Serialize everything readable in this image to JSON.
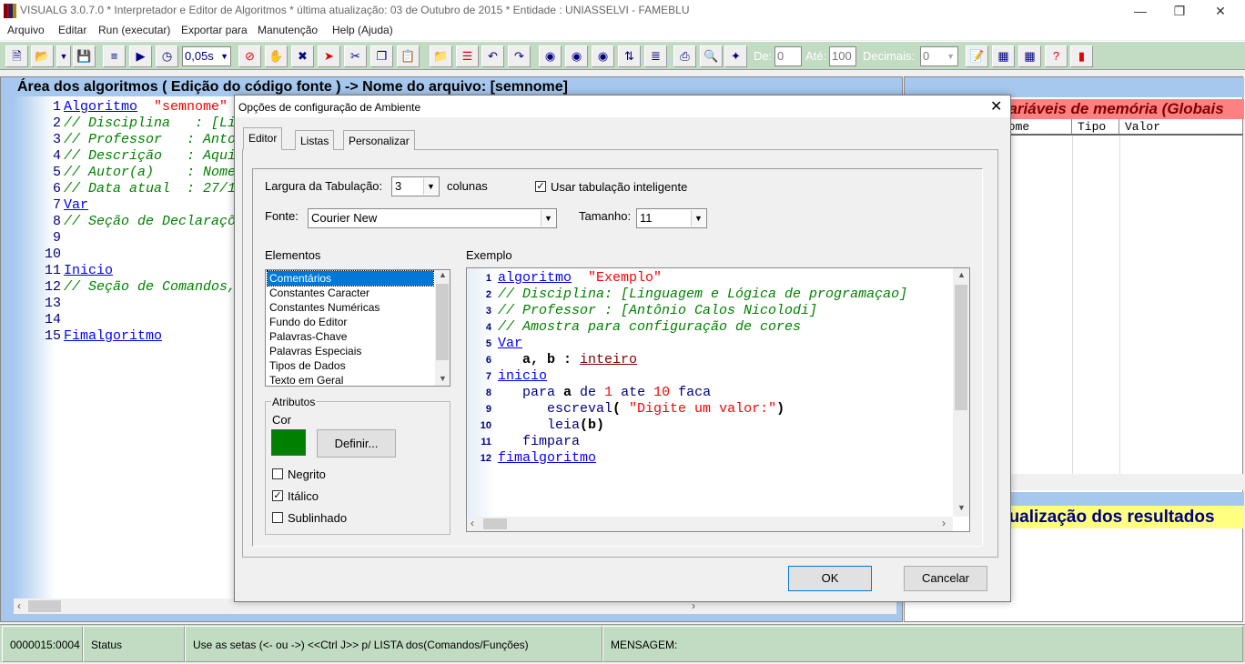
{
  "window": {
    "title": "VISUALG 3.0.7.0 * Interpretador e Editor de Algoritmos * última atualização: 03 de Outubro de 2015 * Entidade : UNIASSELVI - FAMEBLU",
    "controls": [
      "minimize-icon",
      "maximize-icon",
      "close-icon"
    ]
  },
  "menu": [
    "Arquivo",
    "Editar",
    "Run (executar)",
    "Exportar para",
    "Manutenção",
    "Help (Ajuda)"
  ],
  "toolbar": {
    "speed": "0,05s",
    "de_label": "De:",
    "de_value": "0",
    "ate_label": "Até:",
    "ate_value": "100",
    "decimais_label": "Decimais:",
    "decimais_value": "0",
    "icons": [
      "new-file-icon",
      "open-folder-icon",
      "dropdown-icon",
      "save-icon",
      "indent-icon",
      "run-step-icon",
      "timer-icon",
      "stop-icon",
      "hand-icon",
      "no-hand-icon",
      "run-to-icon",
      "cut-icon",
      "copy-icon",
      "paste-icon",
      "export-icon",
      "breakpoint-icon",
      "undo-icon",
      "redo-icon",
      "find-icon",
      "find-next-icon",
      "replace-icon",
      "sort-icon",
      "outdent-icon",
      "print-icon",
      "print-preview-icon",
      "wand-icon",
      "notes-icon",
      "calculator-icon",
      "calendar-icon",
      "help-icon",
      "exit-icon"
    ]
  },
  "editor": {
    "title": "Área dos algoritmos ( Edição do código fonte ) -> Nome do arquivo: [semnome]",
    "lines": [
      [
        [
          "kw",
          "Algoritmo"
        ],
        [
          "",
          "  "
        ],
        [
          "str",
          "\"semnome\""
        ]
      ],
      [
        [
          "cm",
          "// Disciplina   : [Li"
        ]
      ],
      [
        [
          "cm",
          "// Professor   : Anto"
        ]
      ],
      [
        [
          "cm",
          "// Descrição   : Aqui"
        ]
      ],
      [
        [
          "cm",
          "// Autor(a)    : Nome"
        ]
      ],
      [
        [
          "cm",
          "// Data atual  : 27/1"
        ]
      ],
      [
        [
          "kw",
          "Var"
        ]
      ],
      [
        [
          "cm",
          "// Seção de Declaraçõ"
        ]
      ],
      [],
      [],
      [
        [
          "kw",
          "Inicio"
        ]
      ],
      [
        [
          "cm",
          "// Seção de Comandos,"
        ]
      ],
      [],
      [],
      [
        [
          "kw",
          "Fimalgoritmo"
        ]
      ]
    ]
  },
  "variables": {
    "title": "variáveis de memória (Globais",
    "columns": [
      "Nome",
      "Tipo",
      "Valor"
    ]
  },
  "results": {
    "title": "sualização dos resultados"
  },
  "status": [
    "0000015:0004",
    "Status",
    "Use as setas (<- ou ->) <<Ctrl J>> p/ LISTA dos(Comandos/Funções)",
    "MENSAGEM:"
  ],
  "dialog": {
    "title": "Opções de configuração de Ambiente",
    "tabs": [
      "Editor",
      "Listas",
      "Personalizar"
    ],
    "tab_width_label": "Largura da Tabulação:",
    "tab_width_value": "3",
    "colunas": "colunas",
    "smart_tab_label": "Usar tabulação inteligente",
    "smart_tab_checked": true,
    "font_label": "Fonte:",
    "font_value": "Courier New",
    "size_label": "Tamanho:",
    "size_value": "11",
    "elements_label": "Elementos",
    "elements": [
      "Comentários",
      "Constantes Caracter",
      "Constantes Numéricas",
      "Fundo do Editor",
      "Palavras-Chave",
      "Palavras Especiais",
      "Tipos de Dados",
      "Texto em Geral"
    ],
    "selected_element": "Comentários",
    "attributes_label": "Atributos",
    "color_label": "Cor",
    "color_value": "#008000",
    "define_button": "Definir...",
    "bold_label": "Negrito",
    "bold": false,
    "italic_label": "Itálico",
    "italic": true,
    "underline_label": "Sublinhado",
    "underline": false,
    "example_label": "Exemplo",
    "example_lines": [
      [
        [
          "kw",
          "algoritmo"
        ],
        [
          "",
          "  "
        ],
        [
          "str",
          "\"Exemplo\""
        ]
      ],
      [
        [
          "cm",
          "// Disciplina: [Linguagem e Lógica de programaçao]"
        ]
      ],
      [
        [
          "cm",
          "// Professor : [Antônio Calos Nicolodi]"
        ]
      ],
      [
        [
          "cm",
          "// Amostra para configuração de cores"
        ]
      ],
      [
        [
          "kw",
          "Var"
        ]
      ],
      [
        [
          "",
          "   "
        ],
        [
          "var",
          "a, b"
        ],
        [
          "var",
          " : "
        ],
        [
          "typ",
          "inteiro"
        ]
      ],
      [
        [
          "kw",
          "inicio"
        ]
      ],
      [
        [
          "",
          "   "
        ],
        [
          "kw2",
          "para "
        ],
        [
          "var",
          "a"
        ],
        [
          "kw2",
          " de "
        ],
        [
          "num",
          "1"
        ],
        [
          "kw2",
          " ate "
        ],
        [
          "num",
          "10"
        ],
        [
          "kw2",
          " faca"
        ]
      ],
      [
        [
          "",
          "      "
        ],
        [
          "kw2",
          "escreval"
        ],
        [
          "var",
          "( "
        ],
        [
          "str",
          "\"Digite um valor:\""
        ],
        [
          "var",
          ")"
        ]
      ],
      [
        [
          "",
          "      "
        ],
        [
          "kw2",
          "leia"
        ],
        [
          "var",
          "(b)"
        ]
      ],
      [
        [
          "",
          "   "
        ],
        [
          "kw2",
          "fimpara"
        ]
      ],
      [
        [
          "kw",
          "fimalgoritmo"
        ]
      ]
    ],
    "ok_button": "OK",
    "cancel_button": "Cancelar"
  }
}
